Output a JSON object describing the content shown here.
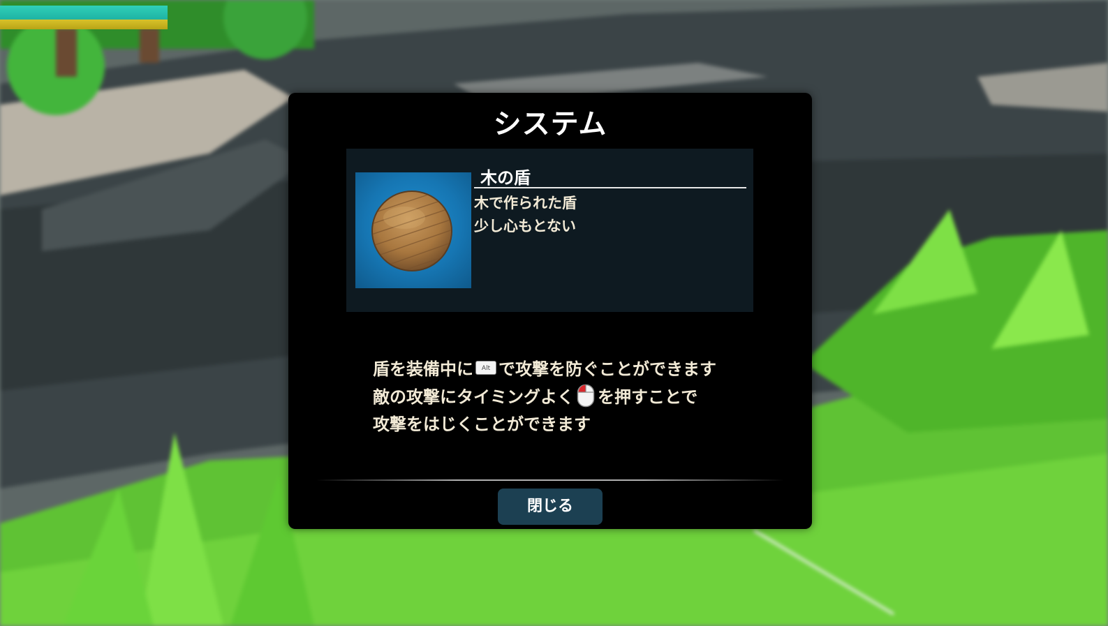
{
  "hud": {
    "hp_fraction": 1.0,
    "stamina_fraction": 1.0,
    "hp_color": "#2fd0b8",
    "stamina_color": "#d8c22a"
  },
  "dialog": {
    "title": "システム",
    "item": {
      "name": "木の盾",
      "description_line_1": "木で作られた盾",
      "description_line_2": "少し心もとない",
      "icon": "wooden-shield-icon"
    },
    "system_text": {
      "line1_before": "盾を装備中に",
      "line1_key_icon": "alt-key-icon",
      "line1_key_label": "Alt",
      "line1_after": "で攻撃を防ぐことができます",
      "line2_before": "敵の攻撃にタイミングよく",
      "line2_mouse_icon": "left-mouse-button-icon",
      "line2_after": "を押すことで",
      "line3": "攻撃をはじくことができます"
    },
    "close_label": "閉じる",
    "colors": {
      "panel_bg": "#0e1a21",
      "button_bg": "#1c4052",
      "text_cream": "#f2ead6"
    }
  }
}
